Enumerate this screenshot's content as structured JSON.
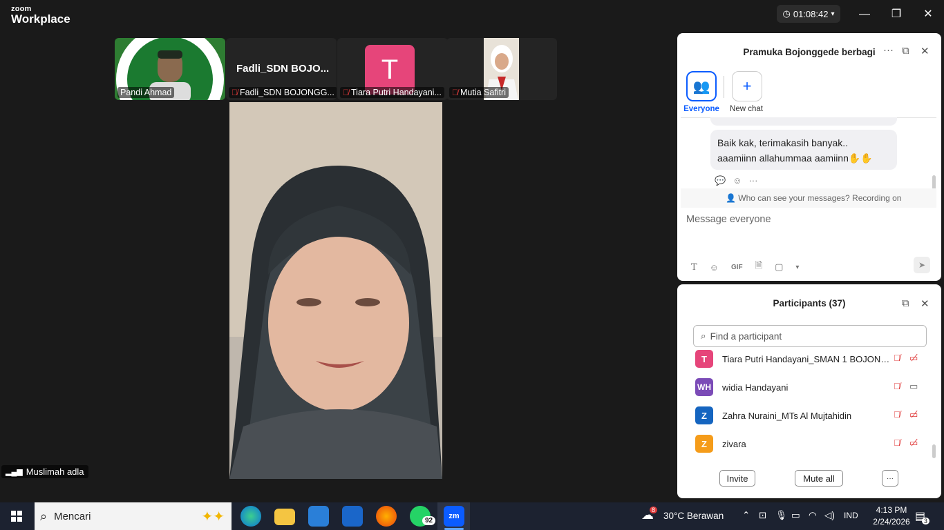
{
  "app": {
    "logo_small": "zoom",
    "logo_big": "Workplace",
    "timer": "01:08:42"
  },
  "tiles": [
    {
      "name": "Pandi Ahmad",
      "muted": false
    },
    {
      "name": "Fadli_SDN BOJONGG...",
      "title": "Fadli_SDN  BOJO...",
      "muted": true
    },
    {
      "name": "Tiara Putri Handayani...",
      "avatar": "T",
      "muted": true
    },
    {
      "name": "Mutia Safitri",
      "muted": true
    }
  ],
  "speaker": {
    "name": "Muslimah adla"
  },
  "chat": {
    "title": "Pramuka Bojonggede berbagi",
    "tabs": [
      {
        "label": "Everyone"
      },
      {
        "label": "New chat"
      }
    ],
    "message_line1": "Baik kak, terimakasih banyak..",
    "message_line2": "aaamiinn allahummaa aamiinn",
    "visibility": "Who can see your messages? Recording on",
    "input_placeholder": "Message everyone",
    "gif_label": "GIF"
  },
  "participants": {
    "title": "Participants (37)",
    "search_placeholder": "Find a participant",
    "list": [
      {
        "initials": "T",
        "name": "Tiara Putri Handayani_SMAN 1 BOJONG...",
        "color": "#e6457a",
        "video": "off"
      },
      {
        "initials": "WH",
        "name": "widia Handayani",
        "color": "#7b4bb7",
        "video": "on"
      },
      {
        "initials": "Z",
        "name": "Zahra Nuraini_MTs Al Mujtahidin",
        "color": "#1565c0",
        "video": "off"
      },
      {
        "initials": "Z",
        "name": "zivara",
        "color": "#f59c1a",
        "video": "off"
      }
    ],
    "invite_label": "Invite",
    "mute_all_label": "Mute all",
    "more_label": "···"
  },
  "taskbar": {
    "search_placeholder": "Mencari",
    "whatsapp_badge": "92",
    "zoom_label": "zm",
    "weather_badge": "8",
    "weather": "30°C  Berawan",
    "lang": "IND",
    "time": "4:13 PM",
    "date": "2/24/2026",
    "notif_count": "3"
  }
}
